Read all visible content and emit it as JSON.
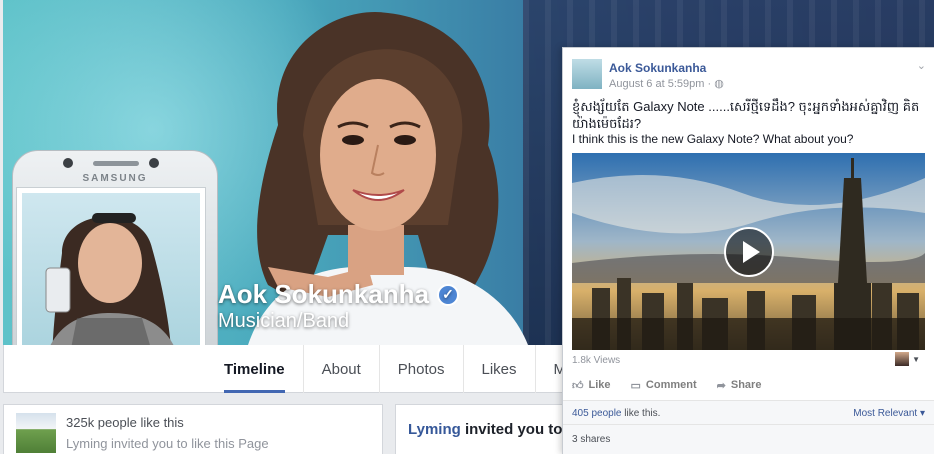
{
  "page": {
    "name": "Aok Sokunkanha",
    "category": "Musician/Band",
    "verified_mark": "✓",
    "phone_brand": "SAMSUNG"
  },
  "tabs": [
    {
      "label": "Timeline",
      "active": true
    },
    {
      "label": "About"
    },
    {
      "label": "Photos"
    },
    {
      "label": "Likes"
    },
    {
      "label": "Mo"
    }
  ],
  "likes_card": {
    "count": "325k people like this",
    "invited": "Lyming invited you to like this Page"
  },
  "invite_card": {
    "name": "Lyming",
    "text": " invited you to"
  },
  "post": {
    "author": "Aok Sokunkanha",
    "timestamp": "August 6 at 5:59pm",
    "privacy_icon": "globe-icon",
    "text_km": "ខ្ញុំសង្ស័យតែ Galaxy Note ......សេរីថ្មីទេដឹង? ចុះអ្នកទាំងអស់គ្នាវិញ គិតយ៉ាងម៉េចដែរ?",
    "text_en": "I think this is the new Galaxy Note? What about you?",
    "views": "1.8k Views",
    "actions": {
      "like": "Like",
      "comment": "Comment",
      "share": "Share"
    },
    "likes": {
      "count": "405 people",
      "suffix": " like this."
    },
    "sort_label": "Most Relevant",
    "shares": "3 shares"
  },
  "colors": {
    "link": "#3b5998",
    "active_tab_underline": "#4267b2",
    "verified_badge": "#4e86d4"
  }
}
